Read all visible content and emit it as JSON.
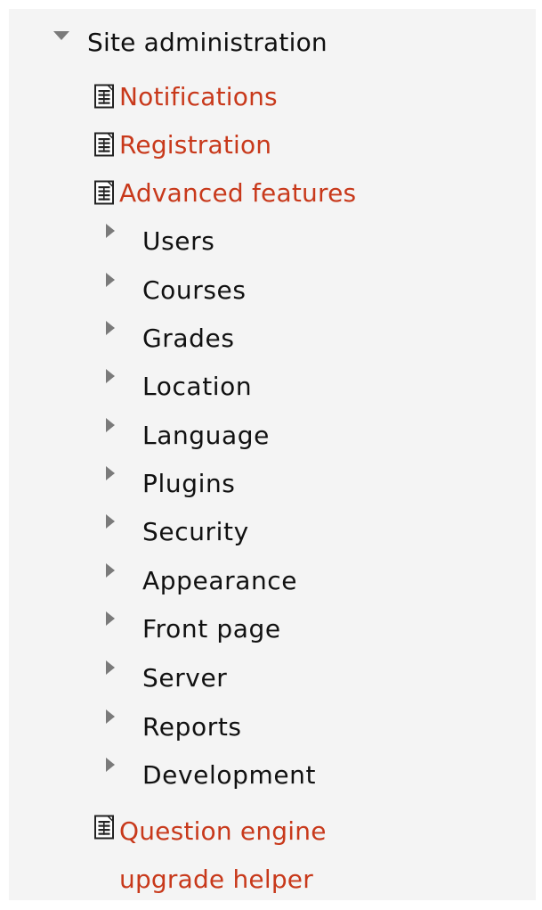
{
  "site_admin": {
    "label": "Site administration",
    "expanded": true,
    "pages": [
      {
        "label": "Notifications"
      },
      {
        "label": "Registration"
      },
      {
        "label": "Advanced features"
      }
    ],
    "categories": [
      {
        "label": "Users"
      },
      {
        "label": "Courses"
      },
      {
        "label": "Grades"
      },
      {
        "label": "Location"
      },
      {
        "label": "Language"
      },
      {
        "label": "Plugins"
      },
      {
        "label": "Security"
      },
      {
        "label": "Appearance"
      },
      {
        "label": "Front page"
      },
      {
        "label": "Server"
      },
      {
        "label": "Reports"
      },
      {
        "label": "Development"
      }
    ],
    "last_page": {
      "label_line1": "Question engine",
      "label_line2": "upgrade helper"
    }
  },
  "colors": {
    "panel_background": "#f4f4f4",
    "link": "#c8391b",
    "text": "#111111",
    "toggle": "#7a7a7a"
  },
  "icons": {
    "expanded_toggle": "triangle-down-icon",
    "collapsed_toggle": "triangle-right-icon",
    "page": "document-page-icon"
  }
}
